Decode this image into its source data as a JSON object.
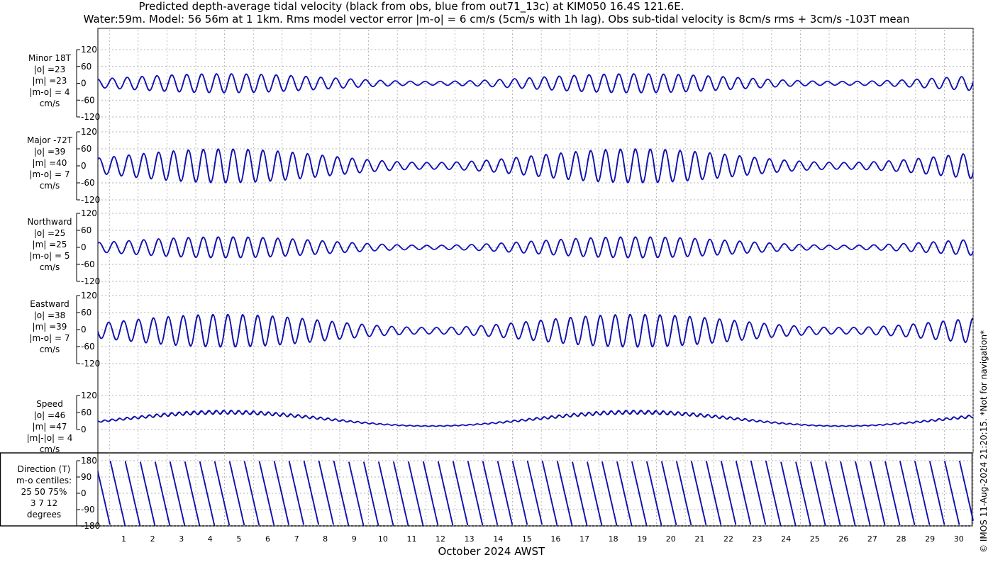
{
  "title_line1": "Predicted depth-average tidal velocity (black from obs, blue from out71_13c) at KIM050 16.4S 121.6E.",
  "title_line2": "Water:59m. Model: 56 56m at 1 1km. Rms model vector error |m-o| = 6 cm/s (5cm/s with 1h lag). Obs sub-tidal velocity is 8cm/s rms + 3cm/s -103T mean",
  "copyright": "© IMOS 11-Aug-2024 21:20:15. *Not for navigation*",
  "colors": {
    "obs": "#000000",
    "model": "#1010cc",
    "grid": "#9a9a9a"
  },
  "chart_data": {
    "type": "line",
    "xlabel": "October 2024 AWST",
    "x_ticks": [
      1,
      2,
      3,
      4,
      5,
      6,
      7,
      8,
      9,
      10,
      11,
      12,
      13,
      14,
      15,
      16,
      17,
      18,
      19,
      20,
      21,
      22,
      23,
      24,
      25,
      26,
      27,
      28,
      29,
      30
    ],
    "xlim": [
      0.6,
      31.0
    ],
    "series_names": [
      "obs",
      "model"
    ],
    "panels": [
      {
        "id": "minor",
        "label_lines": [
          "Minor 18T",
          "|o| =23",
          "|m| =23",
          "|m-o| = 4",
          "cm/s"
        ],
        "yticks": [
          120,
          60,
          0,
          -60,
          -120
        ],
        "ylim": [
          -120,
          120
        ],
        "kind": "wave",
        "amp": 33
      },
      {
        "id": "major",
        "label_lines": [
          "Major -72T",
          "|o| =39",
          "|m| =40",
          "|m-o| = 7",
          "cm/s"
        ],
        "yticks": [
          120,
          60,
          0,
          -60,
          -120
        ],
        "ylim": [
          -120,
          120
        ],
        "kind": "wave",
        "amp": 58
      },
      {
        "id": "north",
        "label_lines": [
          "Northward",
          "|o| =25",
          "|m| =25",
          "|m-o| = 5",
          "cm/s"
        ],
        "yticks": [
          120,
          60,
          0,
          -60,
          -120
        ],
        "ylim": [
          -120,
          120
        ],
        "kind": "wave",
        "amp": 36
      },
      {
        "id": "east",
        "label_lines": [
          "Eastward",
          "|o| =38",
          "|m| =39",
          "|m-o| = 7",
          "cm/s"
        ],
        "yticks": [
          120,
          60,
          0,
          -60,
          -120
        ],
        "ylim": [
          -120,
          120
        ],
        "kind": "wave",
        "amp": 56
      },
      {
        "id": "speed",
        "label_lines": [
          "Speed",
          "|o| =46",
          "|m| =47",
          "|m|-|o| = 4",
          "cm/s"
        ],
        "yticks": [
          120,
          60,
          0
        ],
        "ylim": [
          0,
          120
        ],
        "kind": "speed",
        "amp": 60
      },
      {
        "id": "direction",
        "label_lines": [
          "Direction (T)",
          "m-o centiles:",
          "25  50  75%",
          "3   7  12",
          "degrees"
        ],
        "yticks": [
          180,
          90,
          0,
          -90,
          -180
        ],
        "ylim": [
          -180,
          180
        ],
        "kind": "direction",
        "amp": 180
      }
    ]
  }
}
